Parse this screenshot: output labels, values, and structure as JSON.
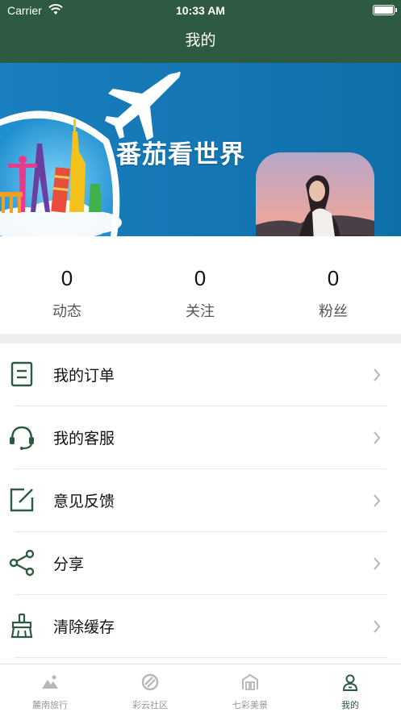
{
  "status_bar": {
    "carrier": "Carrier",
    "time": "10:33 AM"
  },
  "nav": {
    "title": "我的"
  },
  "banner": {
    "slogan": "番茄看世界"
  },
  "stats": [
    {
      "value": "0",
      "label": "动态"
    },
    {
      "value": "0",
      "label": "关注"
    },
    {
      "value": "0",
      "label": "粉丝"
    }
  ],
  "menu": [
    {
      "label": "我的订单",
      "icon": "order-list-icon"
    },
    {
      "label": "我的客服",
      "icon": "headset-icon"
    },
    {
      "label": "意见反馈",
      "icon": "feedback-edit-icon"
    },
    {
      "label": "分享",
      "icon": "share-icon"
    },
    {
      "label": "清除缓存",
      "icon": "broom-icon"
    }
  ],
  "tabs": [
    {
      "label": "麓南旅行",
      "icon": "mountain-icon",
      "active": false
    },
    {
      "label": "彩云社区",
      "icon": "community-icon",
      "active": false
    },
    {
      "label": "七彩美景",
      "icon": "scenery-icon",
      "active": false
    },
    {
      "label": "我的",
      "icon": "profile-icon",
      "active": true
    }
  ],
  "colors": {
    "primary": "#2d5a40",
    "banner_blue": "#1b87c1",
    "inactive_tab": "#9a9a9a"
  }
}
